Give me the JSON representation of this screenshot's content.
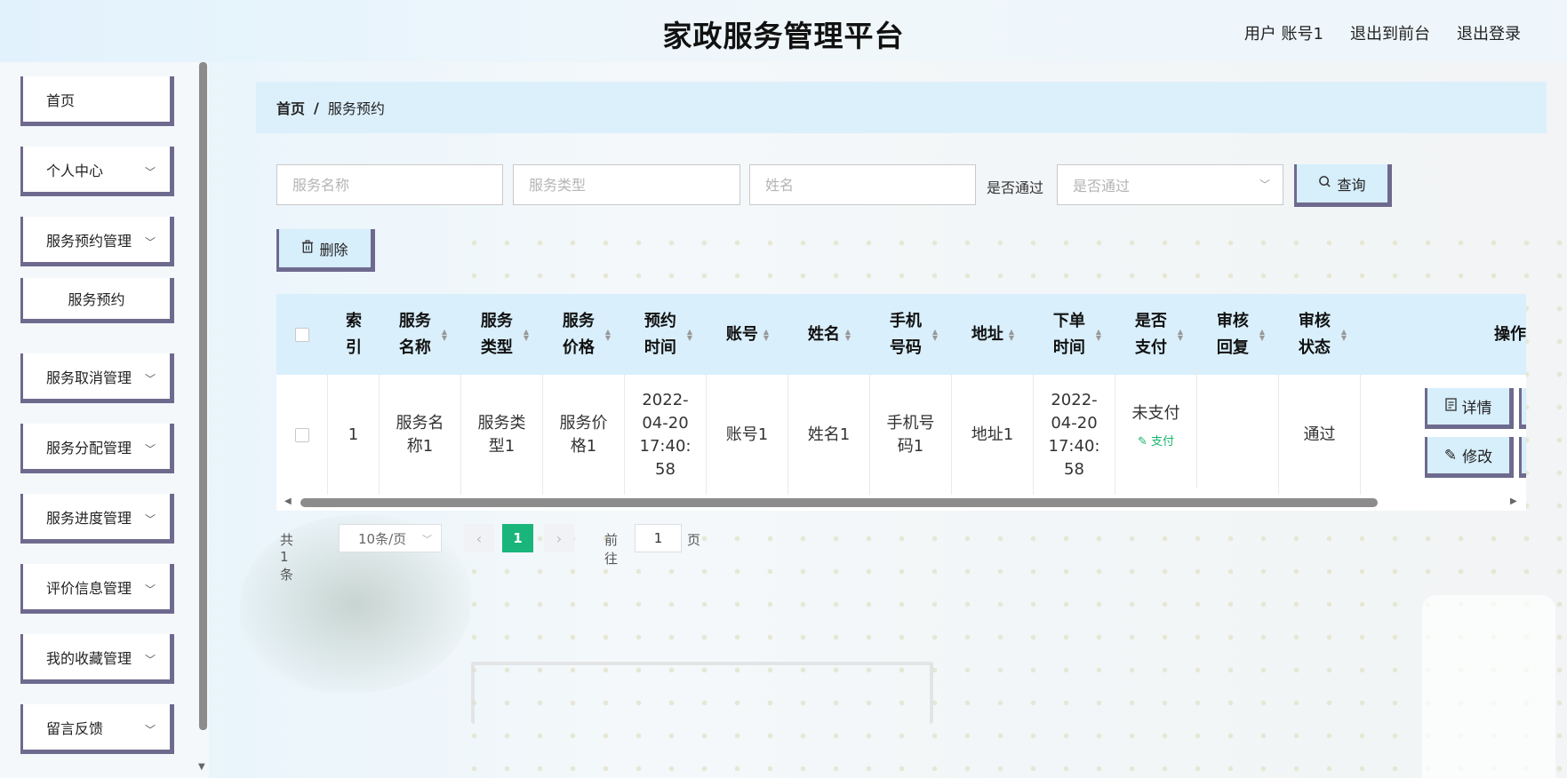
{
  "header": {
    "title": "家政服务管理平台",
    "user_label": "用户 账号1",
    "to_front": "退出到前台",
    "logout": "退出登录"
  },
  "sidebar": {
    "items": [
      {
        "label": "首页"
      },
      {
        "label": "个人中心"
      },
      {
        "label": "服务预约管理"
      },
      {
        "label": "服务预约"
      },
      {
        "label": "服务取消管理"
      },
      {
        "label": "服务分配管理"
      },
      {
        "label": "服务进度管理"
      },
      {
        "label": "评价信息管理"
      },
      {
        "label": "我的收藏管理"
      },
      {
        "label": "留言反馈"
      }
    ]
  },
  "breadcrumb": {
    "home": "首页",
    "sep": "/",
    "current": "服务预约"
  },
  "search": {
    "service_name_placeholder": "服务名称",
    "service_type_placeholder": "服务类型",
    "name_placeholder": "姓名",
    "pass_label": "是否通过",
    "pass_placeholder": "是否通过",
    "query_label": "查询",
    "delete_label": "删除"
  },
  "table": {
    "headers": {
      "index": "索引",
      "service_name": "服务名称",
      "service_type": "服务类型",
      "service_price": "服务价格",
      "appoint_time": "预约时间",
      "account": "账号",
      "name": "姓名",
      "phone": "手机号码",
      "address": "地址",
      "order_time": "下单时间",
      "paid": "是否支付",
      "review_reply": "审核回复",
      "review_status": "审核状态",
      "ops": "操作"
    },
    "rows": [
      {
        "index": "1",
        "service_name": "服务名称1",
        "service_type": "服务类型1",
        "service_price": "服务价格1",
        "appoint_time": "2022-04-20 17:40:58",
        "account": "账号1",
        "name": "姓名1",
        "phone": "手机号码1",
        "address": "地址1",
        "order_time": "2022-04-20 17:40:58",
        "paid": "未支付",
        "pay_link": "支付",
        "review_reply": "",
        "review_status": "通过",
        "detail_label": "详情",
        "edit_label": "修改"
      }
    ]
  },
  "pagination": {
    "total": "共 1 条",
    "page_size": "10条/页",
    "current": "1",
    "goto_label": "前往",
    "goto_value": "1",
    "page_label": "页"
  },
  "colors": {
    "accent": "#19b57a",
    "border": "#6e6a8e",
    "header_bg": "#d9effb"
  }
}
